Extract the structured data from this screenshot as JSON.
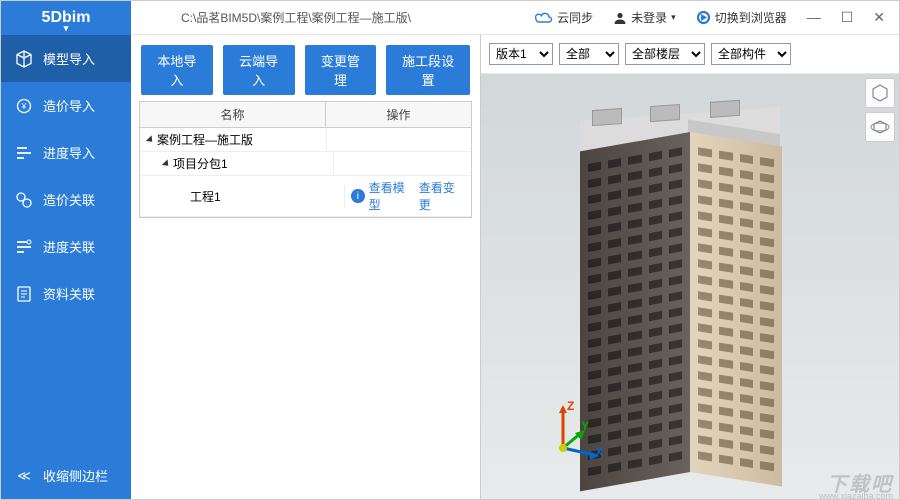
{
  "titlebar": {
    "logo": "5Dbim",
    "path": "C:\\品茗BIM5D\\案例工程\\案例工程—施工版\\",
    "cloud_sync": "云同步",
    "login": "未登录",
    "browser_switch": "切换到浏览器",
    "min_glyph": "—",
    "max_glyph": "☐",
    "close_glyph": "✕"
  },
  "sidebar": {
    "items": [
      {
        "label": "模型导入"
      },
      {
        "label": "造价导入"
      },
      {
        "label": "进度导入"
      },
      {
        "label": "造价关联"
      },
      {
        "label": "进度关联"
      },
      {
        "label": "资料关联"
      }
    ],
    "collapse": "收缩侧边栏"
  },
  "toolbar": {
    "local_import": "本地导入",
    "cloud_import": "云端导入",
    "change_mgmt": "变更管理",
    "section_setup": "施工段设置"
  },
  "table": {
    "col_name": "名称",
    "col_op": "操作",
    "rows": [
      {
        "name": "案例工程—施工版",
        "indent": 0
      },
      {
        "name": "项目分包1",
        "indent": 1
      },
      {
        "name": "工程1",
        "indent": 2,
        "ops": {
          "view_model": "查看模型",
          "view_change": "查看变更"
        }
      }
    ]
  },
  "viewer": {
    "version_select": "版本1",
    "filter_all": "全部",
    "filter_floors": "全部楼层",
    "filter_components": "全部构件",
    "axis": {
      "x": "X",
      "y": "Y",
      "z": "Z"
    }
  },
  "watermark": {
    "main": "下载吧",
    "sub": "www.xiazaiba.com"
  }
}
